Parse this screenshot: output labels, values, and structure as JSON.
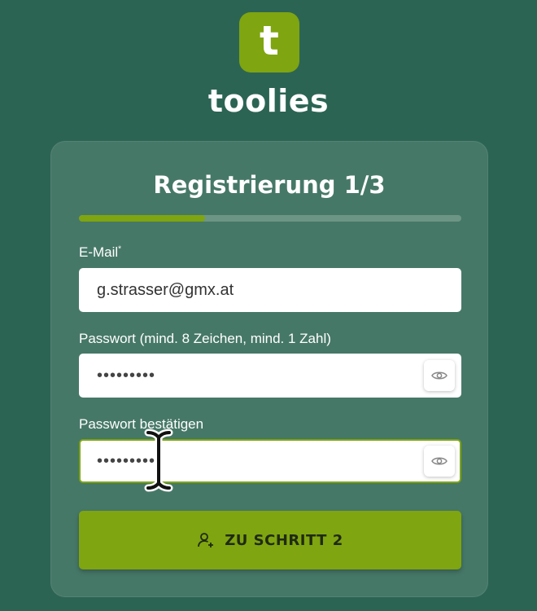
{
  "brand": {
    "logo_letter": "t",
    "name": "toolies",
    "accent": "#7fa510"
  },
  "form": {
    "title": "Registrierung 1/3",
    "progress": 0.33,
    "email": {
      "label": "E-Mail",
      "required_mark": "*",
      "value": "g.strasser@gmx.at"
    },
    "password": {
      "label": "Passwort (mind. 8 Zeichen, mind. 1 Zahl)",
      "masked": "•••••••••",
      "toggle_icon": "eye-icon"
    },
    "confirm": {
      "label": "Passwort bestätigen",
      "masked": "•••••••••",
      "toggle_icon": "eye-icon"
    },
    "submit": {
      "label": "ZU SCHRITT 2",
      "icon": "add-user-icon"
    }
  }
}
